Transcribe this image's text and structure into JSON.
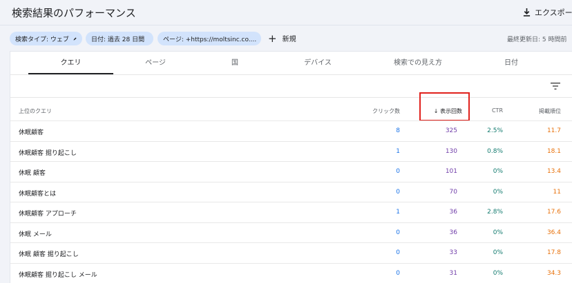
{
  "header": {
    "title": "検索結果のパフォーマンス",
    "export_label": "エクスポート"
  },
  "filters": {
    "chips": [
      {
        "label": "検索タイプ: ウェブ",
        "icon": "pencil-icon"
      },
      {
        "label": "日付: 過去 28 日間",
        "icon": "pencil-icon"
      },
      {
        "label": "ページ: +https://moltsinc.co....",
        "icon": "close-icon"
      }
    ],
    "new_label": "新規",
    "updated": "最終更新日: 5 時間前"
  },
  "tabs": [
    "クエリ",
    "ページ",
    "国",
    "デバイス",
    "検索での見え方",
    "日付"
  ],
  "table": {
    "headers": {
      "query": "上位のクエリ",
      "clicks": "クリック数",
      "impressions": "表示回数",
      "ctr": "CTR",
      "position": "掲載順位"
    },
    "rows": [
      {
        "query": "休眠顧客",
        "clicks": "8",
        "impressions": "325",
        "ctr": "2.5%",
        "position": "11.7"
      },
      {
        "query": "休眠顧客 掘り起こし",
        "clicks": "1",
        "impressions": "130",
        "ctr": "0.8%",
        "position": "18.1"
      },
      {
        "query": "休眠 顧客",
        "clicks": "0",
        "impressions": "101",
        "ctr": "0%",
        "position": "13.4"
      },
      {
        "query": "休眠顧客とは",
        "clicks": "0",
        "impressions": "70",
        "ctr": "0%",
        "position": "11"
      },
      {
        "query": "休眠顧客 アプローチ",
        "clicks": "1",
        "impressions": "36",
        "ctr": "2.8%",
        "position": "17.6"
      },
      {
        "query": "休眠 メール",
        "clicks": "0",
        "impressions": "36",
        "ctr": "0%",
        "position": "36.4"
      },
      {
        "query": "休眠 顧客 掘り起こし",
        "clicks": "0",
        "impressions": "33",
        "ctr": "0%",
        "position": "17.8"
      },
      {
        "query": "休眠顧客 掘り起こし メール",
        "clicks": "0",
        "impressions": "31",
        "ctr": "0%",
        "position": "34.3"
      }
    ]
  },
  "colors": {
    "clicks": "#1a73e8",
    "impressions": "#6f3ca8",
    "ctr": "#137b6f",
    "position": "#e8710a",
    "highlight_box": "#e0201b"
  }
}
